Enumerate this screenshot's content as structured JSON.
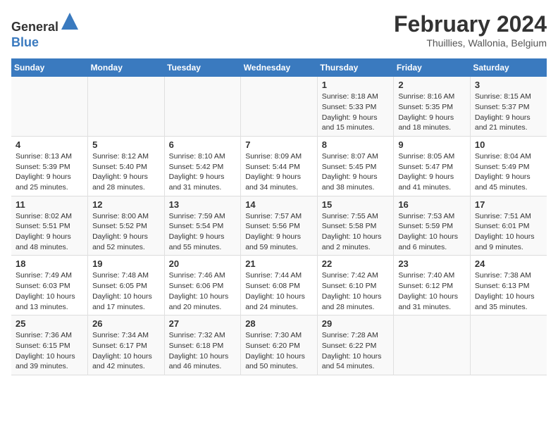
{
  "header": {
    "logo_general": "General",
    "logo_blue": "Blue",
    "month_year": "February 2024",
    "location": "Thuillies, Wallonia, Belgium"
  },
  "calendar": {
    "days_of_week": [
      "Sunday",
      "Monday",
      "Tuesday",
      "Wednesday",
      "Thursday",
      "Friday",
      "Saturday"
    ],
    "weeks": [
      [
        {
          "day": "",
          "info": ""
        },
        {
          "day": "",
          "info": ""
        },
        {
          "day": "",
          "info": ""
        },
        {
          "day": "",
          "info": ""
        },
        {
          "day": "1",
          "info": "Sunrise: 8:18 AM\nSunset: 5:33 PM\nDaylight: 9 hours\nand 15 minutes."
        },
        {
          "day": "2",
          "info": "Sunrise: 8:16 AM\nSunset: 5:35 PM\nDaylight: 9 hours\nand 18 minutes."
        },
        {
          "day": "3",
          "info": "Sunrise: 8:15 AM\nSunset: 5:37 PM\nDaylight: 9 hours\nand 21 minutes."
        }
      ],
      [
        {
          "day": "4",
          "info": "Sunrise: 8:13 AM\nSunset: 5:39 PM\nDaylight: 9 hours\nand 25 minutes."
        },
        {
          "day": "5",
          "info": "Sunrise: 8:12 AM\nSunset: 5:40 PM\nDaylight: 9 hours\nand 28 minutes."
        },
        {
          "day": "6",
          "info": "Sunrise: 8:10 AM\nSunset: 5:42 PM\nDaylight: 9 hours\nand 31 minutes."
        },
        {
          "day": "7",
          "info": "Sunrise: 8:09 AM\nSunset: 5:44 PM\nDaylight: 9 hours\nand 34 minutes."
        },
        {
          "day": "8",
          "info": "Sunrise: 8:07 AM\nSunset: 5:45 PM\nDaylight: 9 hours\nand 38 minutes."
        },
        {
          "day": "9",
          "info": "Sunrise: 8:05 AM\nSunset: 5:47 PM\nDaylight: 9 hours\nand 41 minutes."
        },
        {
          "day": "10",
          "info": "Sunrise: 8:04 AM\nSunset: 5:49 PM\nDaylight: 9 hours\nand 45 minutes."
        }
      ],
      [
        {
          "day": "11",
          "info": "Sunrise: 8:02 AM\nSunset: 5:51 PM\nDaylight: 9 hours\nand 48 minutes."
        },
        {
          "day": "12",
          "info": "Sunrise: 8:00 AM\nSunset: 5:52 PM\nDaylight: 9 hours\nand 52 minutes."
        },
        {
          "day": "13",
          "info": "Sunrise: 7:59 AM\nSunset: 5:54 PM\nDaylight: 9 hours\nand 55 minutes."
        },
        {
          "day": "14",
          "info": "Sunrise: 7:57 AM\nSunset: 5:56 PM\nDaylight: 9 hours\nand 59 minutes."
        },
        {
          "day": "15",
          "info": "Sunrise: 7:55 AM\nSunset: 5:58 PM\nDaylight: 10 hours\nand 2 minutes."
        },
        {
          "day": "16",
          "info": "Sunrise: 7:53 AM\nSunset: 5:59 PM\nDaylight: 10 hours\nand 6 minutes."
        },
        {
          "day": "17",
          "info": "Sunrise: 7:51 AM\nSunset: 6:01 PM\nDaylight: 10 hours\nand 9 minutes."
        }
      ],
      [
        {
          "day": "18",
          "info": "Sunrise: 7:49 AM\nSunset: 6:03 PM\nDaylight: 10 hours\nand 13 minutes."
        },
        {
          "day": "19",
          "info": "Sunrise: 7:48 AM\nSunset: 6:05 PM\nDaylight: 10 hours\nand 17 minutes."
        },
        {
          "day": "20",
          "info": "Sunrise: 7:46 AM\nSunset: 6:06 PM\nDaylight: 10 hours\nand 20 minutes."
        },
        {
          "day": "21",
          "info": "Sunrise: 7:44 AM\nSunset: 6:08 PM\nDaylight: 10 hours\nand 24 minutes."
        },
        {
          "day": "22",
          "info": "Sunrise: 7:42 AM\nSunset: 6:10 PM\nDaylight: 10 hours\nand 28 minutes."
        },
        {
          "day": "23",
          "info": "Sunrise: 7:40 AM\nSunset: 6:12 PM\nDaylight: 10 hours\nand 31 minutes."
        },
        {
          "day": "24",
          "info": "Sunrise: 7:38 AM\nSunset: 6:13 PM\nDaylight: 10 hours\nand 35 minutes."
        }
      ],
      [
        {
          "day": "25",
          "info": "Sunrise: 7:36 AM\nSunset: 6:15 PM\nDaylight: 10 hours\nand 39 minutes."
        },
        {
          "day": "26",
          "info": "Sunrise: 7:34 AM\nSunset: 6:17 PM\nDaylight: 10 hours\nand 42 minutes."
        },
        {
          "day": "27",
          "info": "Sunrise: 7:32 AM\nSunset: 6:18 PM\nDaylight: 10 hours\nand 46 minutes."
        },
        {
          "day": "28",
          "info": "Sunrise: 7:30 AM\nSunset: 6:20 PM\nDaylight: 10 hours\nand 50 minutes."
        },
        {
          "day": "29",
          "info": "Sunrise: 7:28 AM\nSunset: 6:22 PM\nDaylight: 10 hours\nand 54 minutes."
        },
        {
          "day": "",
          "info": ""
        },
        {
          "day": "",
          "info": ""
        }
      ]
    ]
  }
}
